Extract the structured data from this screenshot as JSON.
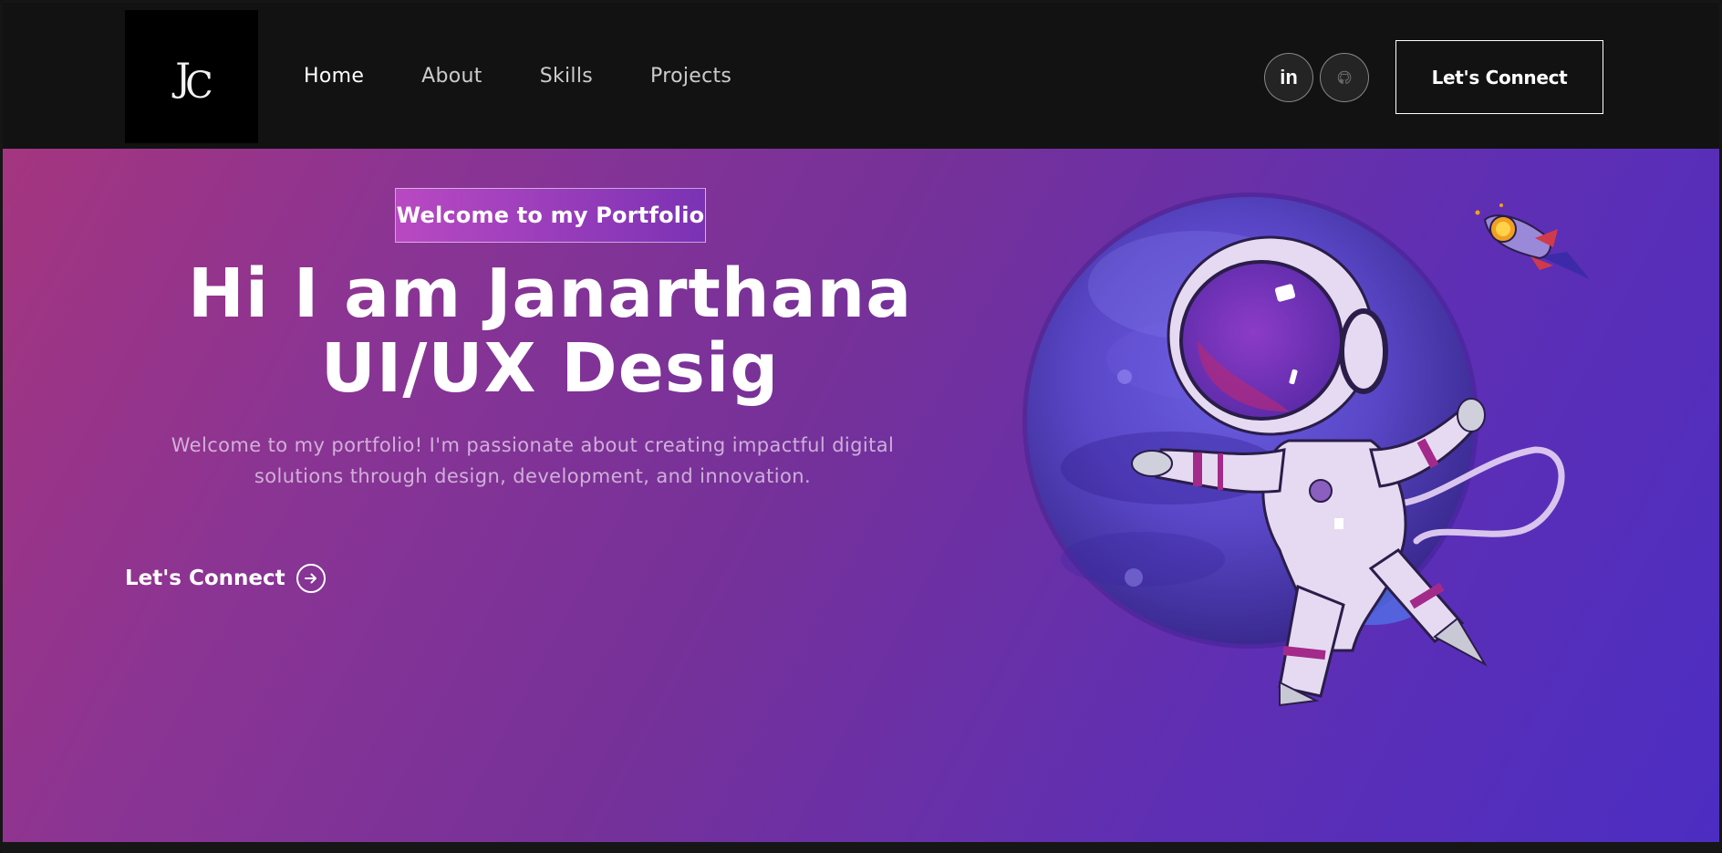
{
  "nav": {
    "logo_letters": [
      "J",
      "C"
    ],
    "links": [
      "Home",
      "About",
      "Skills",
      "Projects"
    ],
    "social_linkedin_label": "in",
    "connect_label": "Let's Connect"
  },
  "hero": {
    "tagline": "Welcome to my Portfolio",
    "headline_line1": "Hi I am Janarthana",
    "headline_line2": "UI/UX Desig",
    "intro": "Welcome to my portfolio! I'm passionate about creating impactful digital solutions through design, development, and innovation.",
    "cta_label": "Let's Connect"
  },
  "icons": {
    "linkedin": "linkedin-icon",
    "github": "github-icon",
    "cta_arrow": "arrow-right-circle-icon"
  },
  "colors": {
    "navbar_bg": "#121212",
    "hero_gradient_start": "#a5357f",
    "hero_gradient_end": "#4c2dc2",
    "text": "#ffffff"
  }
}
